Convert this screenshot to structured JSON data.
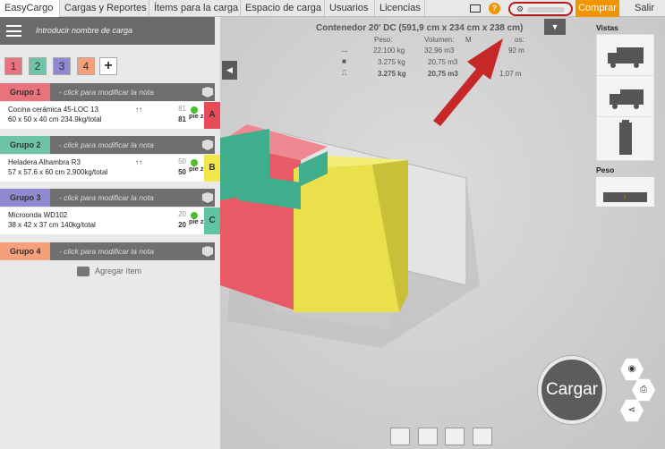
{
  "topnav": {
    "tabs": [
      "EasyCargo",
      "Cargas y Reportes",
      "Ítems para la carga",
      "Espacio de carga",
      "Usuarios",
      "Licencias"
    ],
    "comprar": "Comprar",
    "salir": "Salir",
    "help": "?"
  },
  "search": {
    "placeholder": "Introducir nombre de carga"
  },
  "group_tabs": [
    "1",
    "2",
    "3",
    "4",
    "+"
  ],
  "groups": [
    {
      "label": "Grupo 1",
      "note": "- click para modificar la nota",
      "color": "#e8737d"
    },
    {
      "label": "Grupo 2",
      "note": "- click para modificar la nota",
      "color": "#6fc3a8"
    },
    {
      "label": "Grupo 3",
      "note": "- click para modificar la nota",
      "color": "#8f8ad0"
    },
    {
      "label": "Grupo 4",
      "note": "- click para modificar la nota",
      "color": "#f5a07a"
    }
  ],
  "items": [
    {
      "name": "Cocina cerámica 45-LOC 13",
      "dims": "60 x 50 x 40 cm 234.9kg/total",
      "arrows": "↑↑",
      "q1": "81",
      "q2": "81",
      "piezas": "pie zas",
      "letter": "A",
      "color": "#e64b57"
    },
    {
      "name": "Heladera Alhambra R3",
      "dims": "57 x 57.6 x 60 cm 2,900kg/total",
      "arrows": "↑↑",
      "q1": "50",
      "q2": "50",
      "piezas": "pie zas",
      "letter": "B",
      "color": "#f2e64a"
    },
    {
      "name": "Microonda WD102",
      "dims": "38 x 42 x 37 cm 140kg/total",
      "arrows": "",
      "q1": "20",
      "q2": "20",
      "piezas": "pie zas",
      "letter": "C",
      "color": "#5fc4a2"
    }
  ],
  "add_item": "Agregar ítem",
  "container": {
    "title": "Contenedor 20' DC (591,9 cm x 234 cm x 238 cm)",
    "peso_h": "Peso:",
    "volumen_h": "Volumen:",
    "mh": "M",
    "pos_h": "os:",
    "rows": [
      [
        "22.100 kg",
        "32,96 m3",
        "92 m"
      ],
      [
        "3.275 kg",
        "20,75 m3",
        ""
      ],
      [
        "3.275 kg",
        "20,75 m3",
        "1,07 m"
      ]
    ]
  },
  "sidebar": {
    "vistas": "Vistas",
    "peso": "Peso"
  },
  "cargar": "Cargar"
}
